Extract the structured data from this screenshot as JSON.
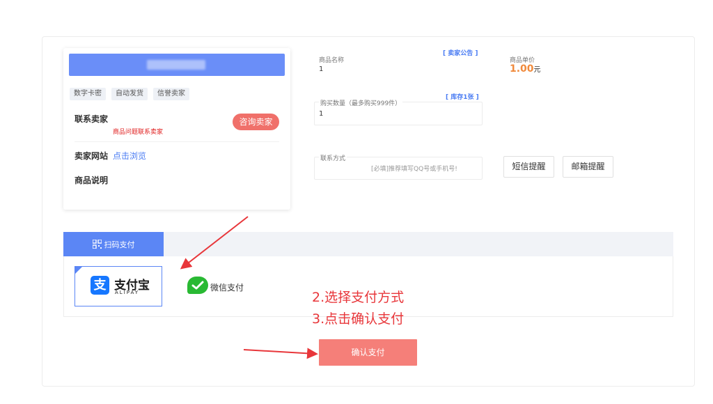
{
  "seller": {
    "tags": [
      "数字卡密",
      "自动发货",
      "信誉卖家"
    ],
    "contact_label": "联系卖家",
    "contact_hint": "商品问题联系卖家",
    "consult_button": "咨询卖家",
    "site_label": "卖家网站",
    "site_link": "点击浏览",
    "desc_label": "商品说明"
  },
  "order": {
    "product_name_label": "商品名称",
    "product_name_value": "1",
    "notice_link": "[ 卖家公告 ]",
    "unit_price_label": "商品单价",
    "unit_price_value": "1.00",
    "unit_price_unit": "元",
    "quantity_label": "购买数量（最多购买999件）",
    "quantity_value": "1",
    "stock_link": "[ 库存1张 ]",
    "contact_label": "联系方式",
    "contact_placeholder": "[必填]推荐填写QQ号或手机号!",
    "sms_button": "短信提醒",
    "email_button": "邮箱提醒"
  },
  "payment": {
    "tab_label": "扫码支付",
    "alipay_cn": "支付宝",
    "alipay_en": "ALIPAY",
    "wechat_label": "微信支付",
    "confirm_button": "确认支付"
  },
  "annotations": {
    "step2": "2.选择支付方式",
    "step3": "3.点击确认支付"
  },
  "colors": {
    "accent_blue": "#5b86f5",
    "banner_blue": "#6a8ef8",
    "price_orange": "#f08a3c",
    "confirm_red": "#f57f79",
    "annotation_red": "#e8363a",
    "wechat_green": "#29b933",
    "alipay_blue": "#1677ff"
  }
}
